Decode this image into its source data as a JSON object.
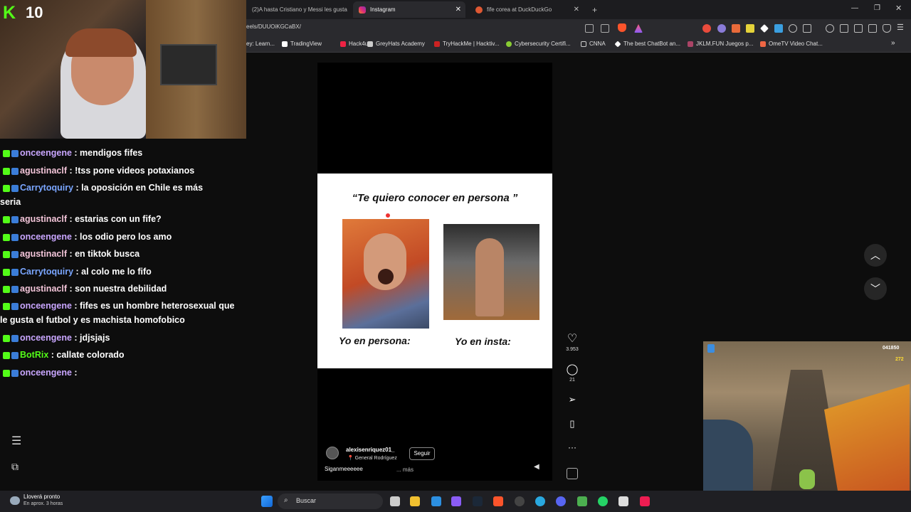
{
  "overlay": {
    "viewer_count": "10",
    "kick_logo": "K"
  },
  "chat": {
    "messages": [
      {
        "user": "onceengene",
        "text": " : mendigos fifes ",
        "color": "#c9a6ff"
      },
      {
        "user": "agustinaclf",
        "text": " : !tss pone videos potaxianos",
        "color": "#f2c4d8"
      },
      {
        "user": "Carrytoquiry",
        "text": " : la oposición en Chile es más",
        "color": "#7aa6ff",
        "cont": "seria"
      },
      {
        "user": "agustinaclf",
        "text": " : estarias con un fife?",
        "color": "#f2c4d8"
      },
      {
        "user": "onceengene",
        "text": " : los odio pero los amo ",
        "color": "#c9a6ff"
      },
      {
        "user": "agustinaclf",
        "text": " : en tiktok busca",
        "color": "#f2c4d8"
      },
      {
        "user": "Carrytoquiry",
        "text": " : al colo me lo fifo",
        "color": "#7aa6ff"
      },
      {
        "user": "agustinaclf",
        "text": " : son nuestra debilidad",
        "color": "#f2c4d8"
      },
      {
        "user": "onceengene",
        "text": " : fifes es un hombre heterosexual que",
        "color": "#c9a6ff",
        "cont": "le gusta el futbol y es machista homofobico"
      },
      {
        "user": "onceengene",
        "text": " : jdjsjajs",
        "color": "#c9a6ff"
      },
      {
        "user": "BotRix",
        "text": " : callate colorado",
        "color": "#53fc18"
      },
      {
        "user": "onceengene",
        "text": " : ",
        "color": "#c9a6ff"
      }
    ]
  },
  "browser": {
    "tabs": [
      {
        "label": "(2)A hasta Cristiano y Messi les gusta"
      },
      {
        "label": "Instagram"
      },
      {
        "label": "fife corea at DuckDuckGo"
      }
    ],
    "new_tab": "+",
    "url": "eels/DUUOiKGCaBX/",
    "bookmarks": [
      "ey: Learn...",
      "TradingView",
      "Hack4u",
      "GreyHats Academy",
      "TryHackMe | Hacktiv...",
      "Cybersecurity Certifi...",
      "CNNA",
      "The best ChatBot an...",
      "JKLM.FUN Juegos p...",
      "OmeTV Video Chat..."
    ],
    "more": "»"
  },
  "reel": {
    "meme_title": "“Te quiero conocer en persona ”",
    "caption_left": "Yo en persona:",
    "caption_right": "Yo en insta:",
    "likes": "3.953",
    "comments": "21",
    "author": "alexisenriquez01_",
    "location": "General Rodríguez",
    "follow": "Seguir",
    "description": "Siganmeeeeee",
    "more": "... más",
    "more_dots": "···"
  },
  "taskbar": {
    "weather_title": "Lloverá pronto",
    "weather_sub": "En aprox. 3 horas",
    "search_placeholder": "Buscar"
  },
  "game": {
    "score": "041850",
    "coins": "272"
  }
}
